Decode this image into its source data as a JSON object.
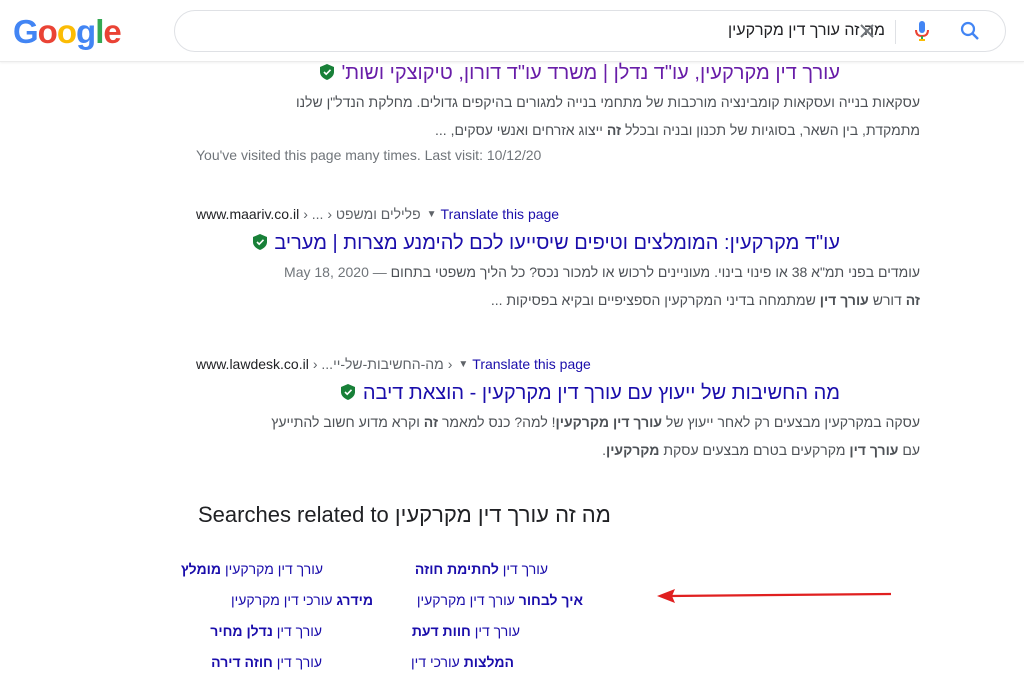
{
  "header": {
    "logo_letters": [
      "G",
      "o",
      "o",
      "g",
      "l",
      "e"
    ],
    "logo_colors": [
      "#4285F4",
      "#EA4335",
      "#FBBC05",
      "#4285F4",
      "#34A853",
      "#EA4335"
    ],
    "search_query": "מה זה עורך דין מקרקעין",
    "clear_icon": "close-icon",
    "mic_icon": "mic-icon",
    "search_icon": "search-icon"
  },
  "results": [
    {
      "title": "עורך דין מקרקעין, עו\"ד נדלן | משרד עו\"ד דורון, טיקוצקי ושות'",
      "visited": true,
      "snippet_line1": "עסקאות בנייה ועסקאות קומבינציה מורכבות של מתחמי בנייה למגורים בהיקפים גדולים. מחלקת הנדל\"ן שלנו",
      "snippet_line2_a": "מתמקדת, בין השאר, בסוגיות של תכנון ובניה ובכלל ",
      "snippet_line2_b": "זה",
      "snippet_line2_c": " ייצוג אזרחים ואנשי עסקים, ...",
      "visited_note": "You've visited this page many times. Last visit: 10/12/20"
    },
    {
      "url": "www.maariv.co.il",
      "breadcrumb": "› ... › פלילים ומשפט",
      "translate": "Translate this page",
      "title": "עו\"ד מקרקעין: המומלצים וטיפים שיסייעו לכם להימנע מצרות | מעריב",
      "snippet_line1": "עומדים בפני תמ\"א 38 או פינוי בינוי. מעוניינים לרכוש או למכור נכס? כל הליך משפטי בתחום",
      "date": "May 18, 2020",
      "date_sep": " — ",
      "snippet_line2_a": "זה",
      "snippet_line2_b": " דורש ",
      "snippet_line2_c": "עורך דין",
      "snippet_line2_d": " שמתמחה בדיני המקרקעין הספציפיים ובקיא בפסיקות ..."
    },
    {
      "url": "www.lawdesk.co.il",
      "breadcrumb": "› ...מה-החשיבות-של-יי ›",
      "translate": "Translate this page",
      "title": "מה החשיבות של ייעוץ עם עורך דין מקרקעין - הוצאת דיבה",
      "snippet_line1_a": "עסקה במקרקעין מבצעים רק לאחר ייעוץ של ",
      "snippet_line1_b": "עורך דין מקרקעין",
      "snippet_line1_c": "! למה? כנס למאמר ",
      "snippet_line1_d": "זה",
      "snippet_line1_e": " וקרא מדוע חשוב להתייעץ",
      "snippet_line2_a": "עם ",
      "snippet_line2_b": "עורך דין",
      "snippet_line2_c": " מקרקעים בטרם מבצעים עסקת ",
      "snippet_line2_d": "מקרקעין",
      "snippet_line2_e": "."
    }
  ],
  "related": {
    "title": "Searches related to מה זה עורך דין מקרקעין",
    "items": [
      {
        "plain": "עורך דין ",
        "bold": "לחתימת חוזה"
      },
      {
        "plain": "עורך דין מקרקעין ",
        "bold": "מומלץ"
      },
      {
        "plain": " עורך דין מקרקעין",
        "bold": "איך לבחור"
      },
      {
        "plain": " עורכי דין מקרקעין",
        "bold": "מידרג"
      },
      {
        "plain": "עורך דין ",
        "bold": "חוות דעת"
      },
      {
        "plain": "עורך דין ",
        "bold": "נדלן מחיר"
      },
      {
        "plain": " עורכי דין",
        "bold": "המלצות"
      },
      {
        "plain": "עורך דין ",
        "bold": "חוזה דירה"
      }
    ]
  },
  "annotation": {
    "arrow_color": "#e02020"
  }
}
